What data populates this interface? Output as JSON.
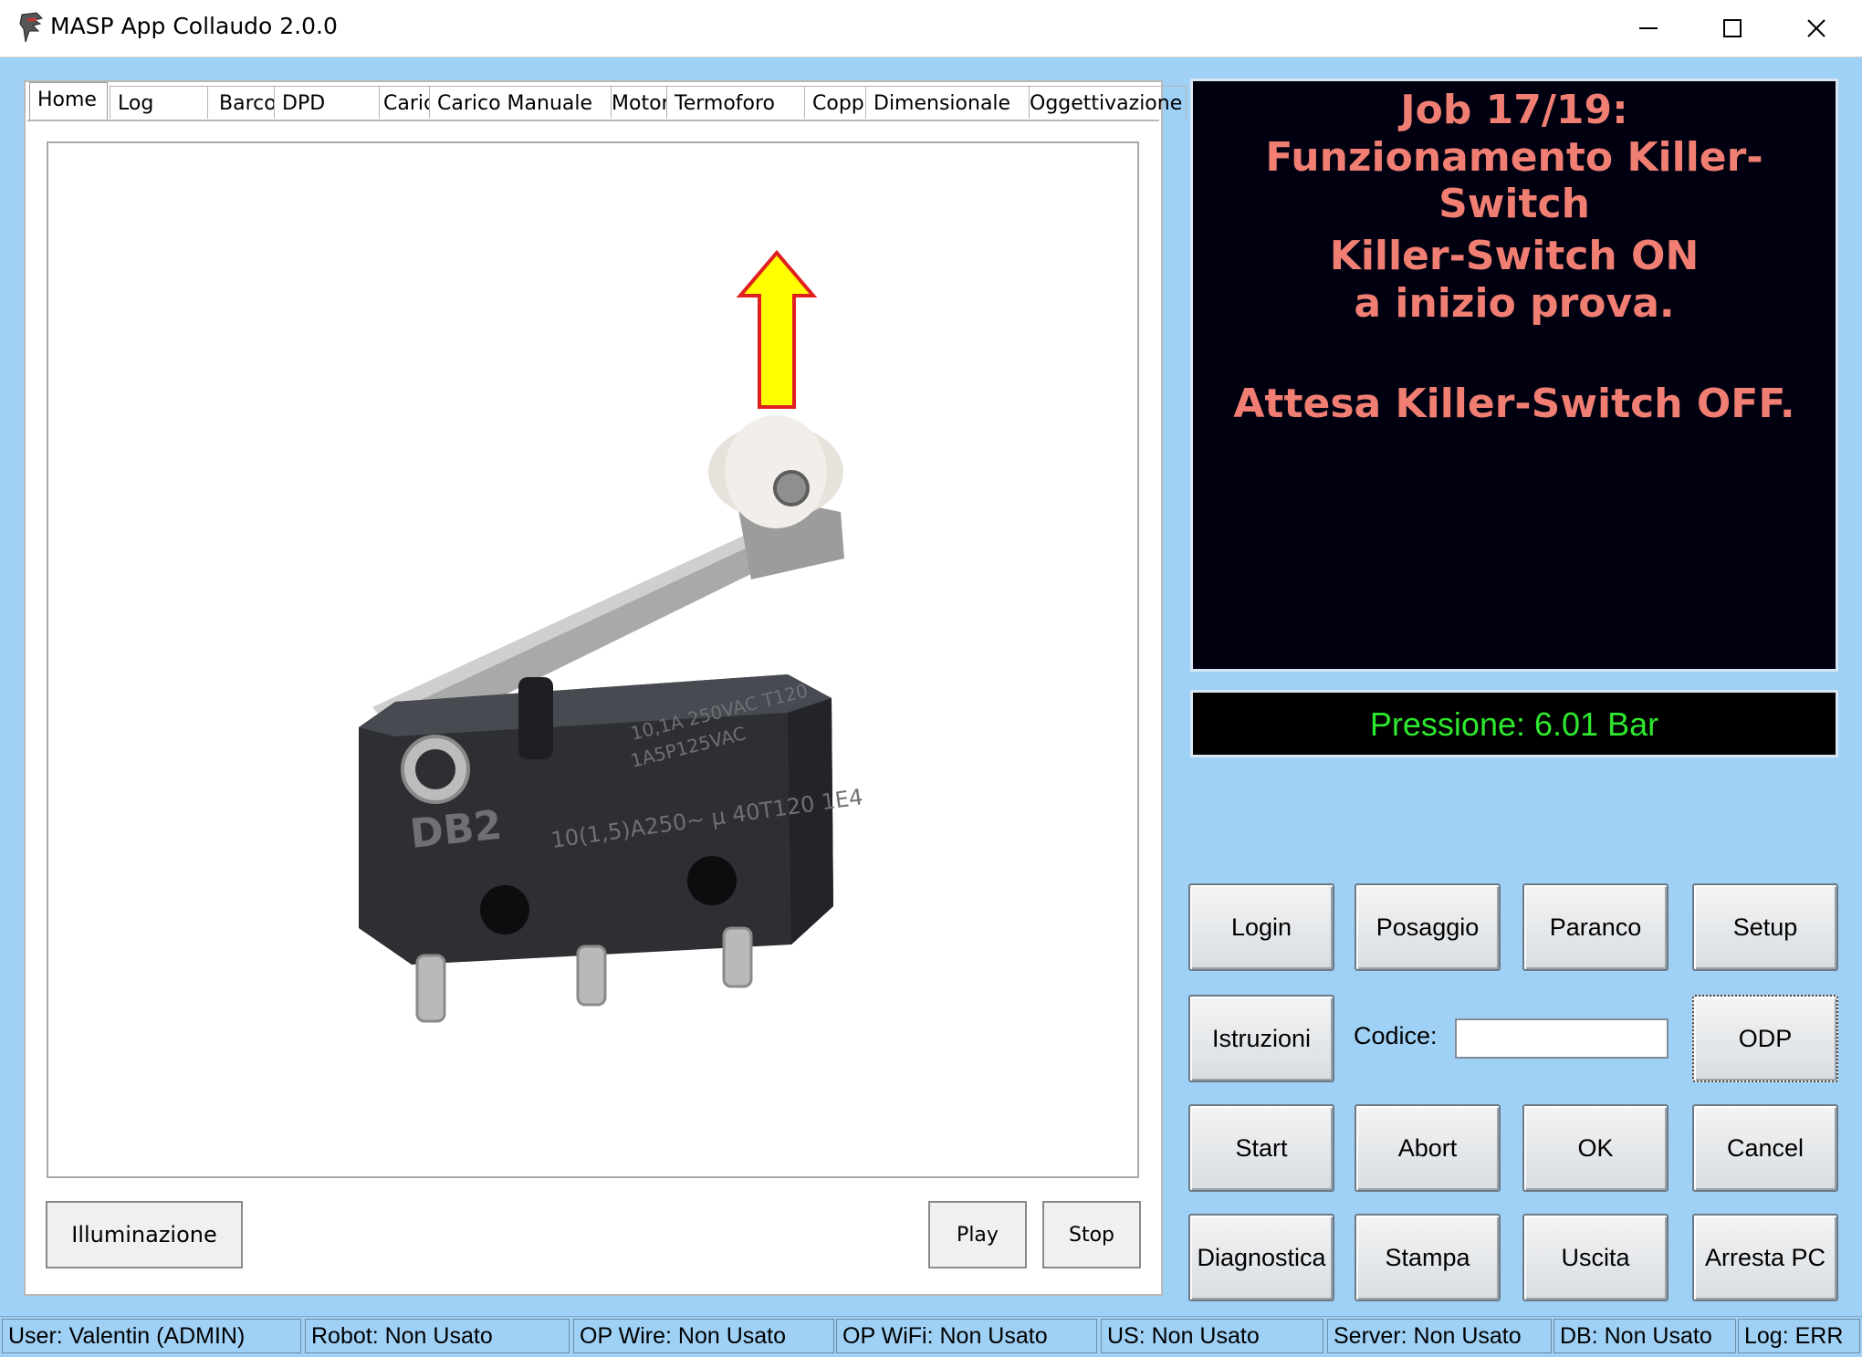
{
  "window": {
    "title": "MASP App Collaudo 2.0.0",
    "minimize_icon": "minimize-icon",
    "maximize_icon": "maximize-icon",
    "close_icon": "close-icon"
  },
  "tabs": [
    {
      "label": "Home",
      "active": true
    },
    {
      "label": "Log"
    },
    {
      "label": "Barcode"
    },
    {
      "label": "DPD"
    },
    {
      "label": "Carico"
    },
    {
      "label": "Carico Manuale"
    },
    {
      "label": "Motore"
    },
    {
      "label": "Termoforo"
    },
    {
      "label": "Coppia"
    },
    {
      "label": "Dimensionale"
    },
    {
      "label": "Oggettivazione"
    }
  ],
  "image_panel": {
    "image": "microswitch-with-roller-lever",
    "arrow": "up-arrow-icon",
    "switch_marking_model": "DB2",
    "switch_marking_line1": "10,1A 250VAC T120",
    "switch_marking_line2": "1A5P125VAC",
    "switch_marking_line3": "10(1,5)A250~ μ 40T120 1E4",
    "colors": {
      "arrow_fill": "#ffff00",
      "arrow_stroke": "#e02020"
    }
  },
  "left_buttons": {
    "illuminazione": "Illuminazione",
    "play": "Play",
    "stop": "Stop"
  },
  "job_display": {
    "line1": "Job 17/19:",
    "line2": "Funzionamento Killer-Switch",
    "line3": "Killer-Switch ON",
    "line4": "a inizio prova.",
    "line5": "Attesa Killer-Switch OFF.",
    "colors": {
      "text": "#f07e72",
      "background": "#000010"
    }
  },
  "pressure_display": {
    "text": "Pressione: 6.01 Bar",
    "colors": {
      "text": "#2ee82e",
      "background": "#000000"
    }
  },
  "controls": {
    "login": "Login",
    "posaggio": "Posaggio",
    "paranco": "Paranco",
    "setup": "Setup",
    "istruzioni": "Istruzioni",
    "codice_label": "Codice:",
    "codice_value": "",
    "odp": "ODP",
    "start": "Start",
    "abort": "Abort",
    "ok": "OK",
    "cancel": "Cancel",
    "diagnostica": "Diagnostica",
    "stampa": "Stampa",
    "uscita": "Uscita",
    "arresta_pc": "Arresta PC"
  },
  "status_bar": [
    "User: Valentin (ADMIN)",
    "Robot: Non Usato",
    "OP Wire: Non Usato",
    "OP WiFi: Non Usato",
    "US: Non Usato",
    "Server: Non Usato",
    "DB: Non Usato",
    "Log: ERR"
  ]
}
